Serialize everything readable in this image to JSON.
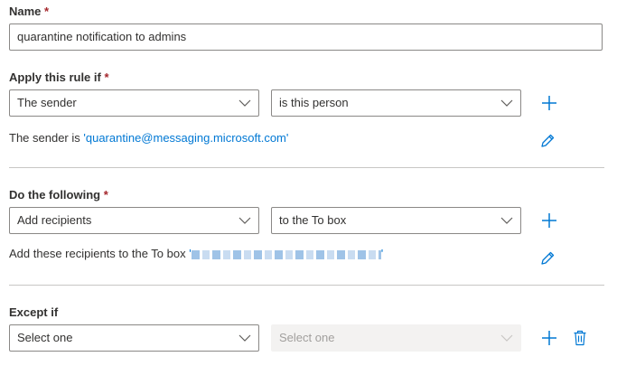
{
  "name_section": {
    "label": "Name",
    "required_mark": "*",
    "value": "quarantine notification to admins"
  },
  "condition_section": {
    "label": "Apply this rule if",
    "required_mark": "*",
    "select1": "The sender",
    "select2": "is this person",
    "desc_prefix": "The sender is ",
    "desc_value": "'quarantine@messaging.microsoft.com'"
  },
  "action_section": {
    "label": "Do the following",
    "required_mark": "*",
    "select1": "Add recipients",
    "select2": "to the To box",
    "desc_prefix": "Add these recipients to the To box ",
    "desc_open_quote": "'",
    "desc_close_quote": "'"
  },
  "exception_section": {
    "label": "Except if",
    "select1": "Select one",
    "select2": "Select one"
  },
  "colors": {
    "accent": "#0078d4",
    "required": "#a4262c",
    "border": "#8a8886",
    "disabled_bg": "#f3f2f1"
  },
  "icons": [
    "chevron-down-icon",
    "plus-icon",
    "pencil-icon",
    "trash-icon"
  ]
}
